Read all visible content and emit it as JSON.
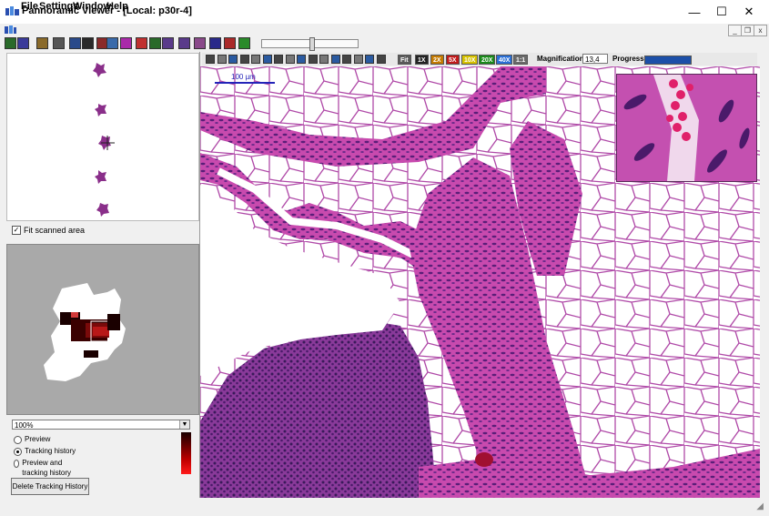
{
  "window": {
    "title": "Pannoramic Viewer - [Local: p30r-4]",
    "minimize_glyph": "—",
    "maximize_glyph": "☐",
    "close_glyph": "✕",
    "mdi_minimize": "_",
    "mdi_restore": "❐",
    "mdi_close": "x"
  },
  "menu": {
    "file": "File",
    "settings": "Settings",
    "window": "Window",
    "help": "Help"
  },
  "left_panel": {
    "fit_scanned_area_label": "Fit scanned area",
    "fit_scanned_area_checked": true,
    "zoom_value": "100%",
    "radio_preview": "Preview",
    "radio_tracking_history": "Tracking history",
    "radio_preview_and_tracking": "Preview and tracking history",
    "selected_mode": "Tracking history",
    "delete_button": "Delete Tracking History",
    "tracking_gradient_colors": [
      "#1a0000",
      "#6b0000",
      "#c00000",
      "#ff1a1a"
    ]
  },
  "viewer_toolbar": {
    "magnification_buttons": [
      {
        "label": "Fit",
        "color": "#5a5a5a"
      },
      {
        "label": "1X",
        "color": "#222222"
      },
      {
        "label": "2X",
        "color": "#c47a00"
      },
      {
        "label": "5X",
        "color": "#c01a1a"
      },
      {
        "label": "10X",
        "color": "#d6c100"
      },
      {
        "label": "20X",
        "color": "#1a8a1a"
      },
      {
        "label": "40X",
        "color": "#2a6fd6"
      },
      {
        "label": "1:1",
        "color": "#6a6a6a"
      }
    ],
    "magnification_label": "Magnification:",
    "magnification_value": "13,4",
    "progress_label": "Progress:",
    "progress_fraction": 1.0
  },
  "viewer": {
    "scale_bar_label": "100 µm",
    "stain_colors": {
      "background": "#f6eef6",
      "stroma": "#c43aa8",
      "nuclei": "#5a2a7a"
    }
  },
  "icons": {
    "toolbar1": [
      "open-icon",
      "save-icon",
      "print-icon",
      "camera-icon",
      "annotation-icon",
      "measure-icon",
      "grid-icon",
      "layout-icon",
      "marker-icon",
      "cut-icon",
      "compare-icon",
      "slide-icon",
      "slide-icon",
      "filter-icon",
      "zoom-in-icon",
      "zoom-out-icon",
      "back-arrow-icon"
    ],
    "toolbar2": [
      "pan-icon",
      "zoom-icon",
      "annotation-icon",
      "rect-icon",
      "ellipse-icon",
      "polygon-icon",
      "arrow-icon",
      "text-icon",
      "ruler-icon",
      "angle-icon",
      "marker-icon",
      "layers-icon",
      "camera-icon",
      "export-icon",
      "info-icon",
      "search-icon"
    ]
  }
}
